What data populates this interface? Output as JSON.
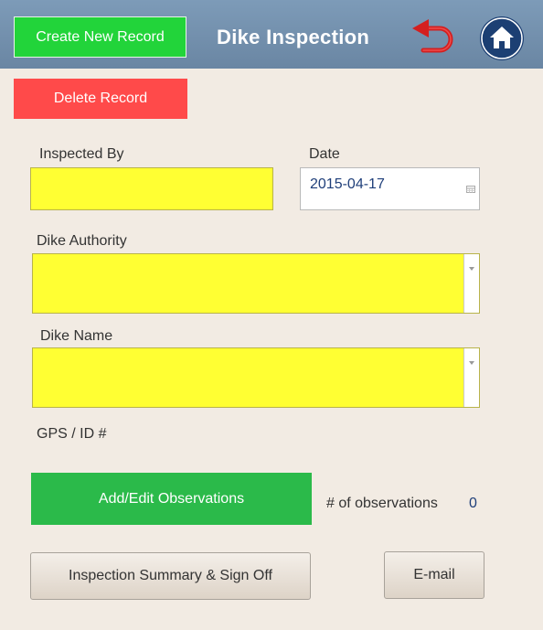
{
  "header": {
    "create_label": "Create New Record",
    "title": "Dike Inspection",
    "back_icon": "undo-arrow-icon",
    "home_icon": "home-icon"
  },
  "actions": {
    "delete_label": "Delete Record"
  },
  "form": {
    "inspected_by": {
      "label": "Inspected By",
      "value": ""
    },
    "date": {
      "label": "Date",
      "value": "2015-04-17"
    },
    "dike_authority": {
      "label": "Dike Authority",
      "value": ""
    },
    "dike_name": {
      "label": "Dike Name",
      "value": ""
    },
    "gps_label": "GPS / ID #"
  },
  "observations": {
    "button_label": "Add/Edit Observations",
    "count_label": "# of observations",
    "count": "0"
  },
  "footer": {
    "summary_label": "Inspection  Summary & Sign Off",
    "email_label": "E-mail"
  },
  "colors": {
    "header_bg": "#6f8ba8",
    "create_green": "#22d43a",
    "delete_red": "#ff4a4a",
    "required_yellow": "#ffff33",
    "action_green": "#2bba4a",
    "page_bg": "#f2ebe3"
  }
}
